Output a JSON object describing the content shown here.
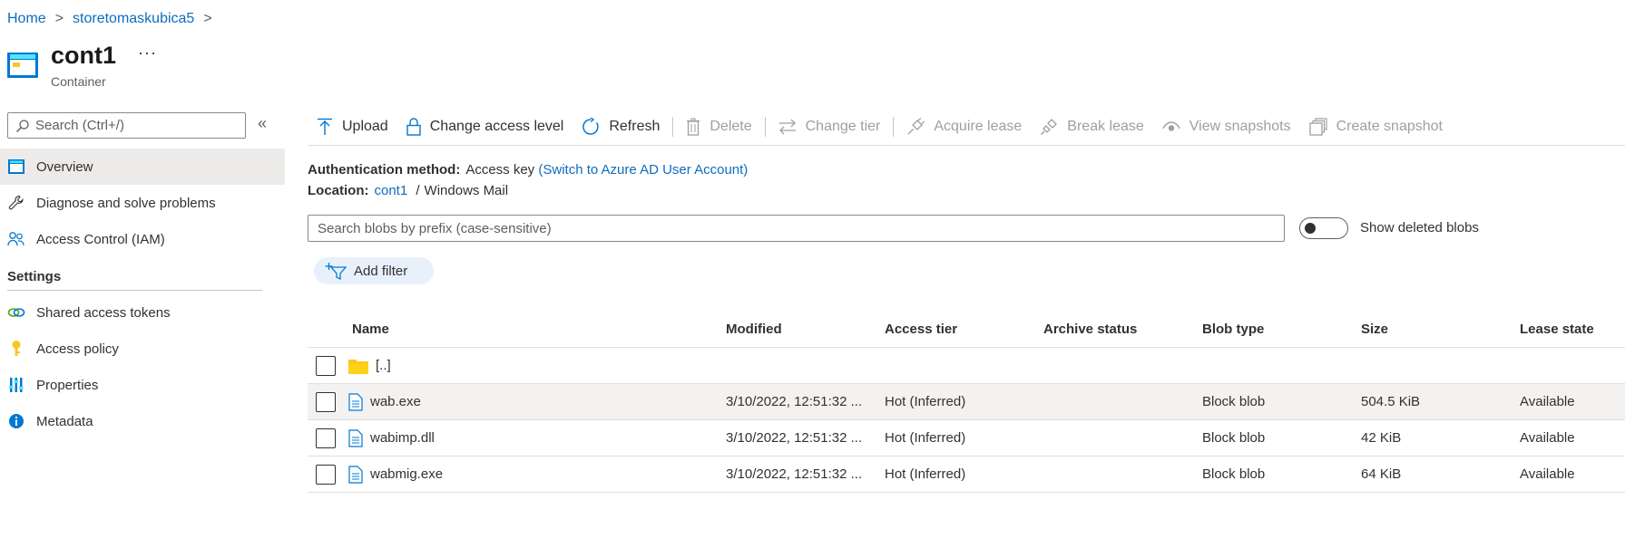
{
  "breadcrumb": {
    "items": [
      "Home",
      "storetomaskubica5"
    ],
    "separator": ">"
  },
  "header": {
    "title": "cont1",
    "more": "···",
    "subtitle": "Container"
  },
  "sidebar": {
    "search_placeholder": "Search (Ctrl+/)",
    "collapse": "«",
    "items": [
      {
        "label": "Overview",
        "icon": "overview-icon",
        "active": true
      },
      {
        "label": "Diagnose and solve problems",
        "icon": "wrench-icon"
      },
      {
        "label": "Access Control (IAM)",
        "icon": "people-icon"
      }
    ],
    "settings_header": "Settings",
    "settings_items": [
      {
        "label": "Shared access tokens",
        "icon": "link-icon"
      },
      {
        "label": "Access policy",
        "icon": "key-icon"
      },
      {
        "label": "Properties",
        "icon": "properties-icon"
      },
      {
        "label": "Metadata",
        "icon": "info-icon"
      }
    ]
  },
  "toolbar": {
    "upload": "Upload",
    "change_access": "Change access level",
    "refresh": "Refresh",
    "delete": "Delete",
    "change_tier": "Change tier",
    "acquire_lease": "Acquire lease",
    "break_lease": "Break lease",
    "view_snapshots": "View snapshots",
    "create_snapshot": "Create snapshot"
  },
  "info": {
    "auth_label": "Authentication method:",
    "auth_value": "Access key",
    "auth_switch": "(Switch to Azure AD User Account)",
    "location_label": "Location:",
    "location_link": "cont1",
    "location_sep": "/",
    "location_path": "Windows Mail"
  },
  "blob_search": {
    "placeholder": "Search blobs by prefix (case-sensitive)",
    "toggle_label": "Show deleted blobs",
    "toggle_on": false
  },
  "filter": {
    "add_filter": "Add filter"
  },
  "table": {
    "columns": [
      "Name",
      "Modified",
      "Access tier",
      "Archive status",
      "Blob type",
      "Size",
      "Lease state"
    ],
    "parent_row": "[..]",
    "rows": [
      {
        "name": "wab.exe",
        "modified": "3/10/2022, 12:51:32 ...",
        "tier": "Hot (Inferred)",
        "archive": "",
        "type": "Block blob",
        "size": "504.5 KiB",
        "lease": "Available"
      },
      {
        "name": "wabimp.dll",
        "modified": "3/10/2022, 12:51:32 ...",
        "tier": "Hot (Inferred)",
        "archive": "",
        "type": "Block blob",
        "size": "42 KiB",
        "lease": "Available"
      },
      {
        "name": "wabmig.exe",
        "modified": "3/10/2022, 12:51:32 ...",
        "tier": "Hot (Inferred)",
        "archive": "",
        "type": "Block blob",
        "size": "64 KiB",
        "lease": "Available"
      }
    ]
  },
  "colors": {
    "accent": "#0f6cbd",
    "folder": "#f8c623",
    "disabled": "#a19f9d"
  }
}
